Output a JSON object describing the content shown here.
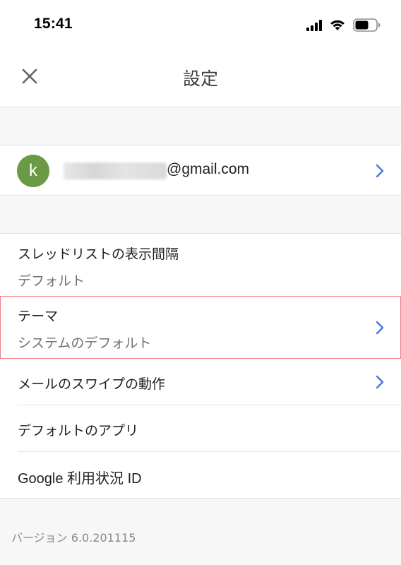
{
  "status_bar": {
    "time": "15:41",
    "icons": [
      "signal-icon",
      "wifi-icon",
      "battery-icon"
    ]
  },
  "header": {
    "close_icon": "close-icon",
    "title": "設定"
  },
  "account": {
    "avatar_letter": "k",
    "avatar_color": "#6a9a45",
    "email_domain": "@gmail.com",
    "email_local_part_redacted": true
  },
  "settings": {
    "items": [
      {
        "title": "スレッドリストの表示間隔",
        "subtitle": "デフォルト",
        "chevron": false
      },
      {
        "title": "テーマ",
        "subtitle": "システムのデフォルト",
        "chevron": true,
        "highlighted": true
      },
      {
        "title": "メールのスワイプの動作",
        "chevron": true
      },
      {
        "title": "デフォルトのアプリ",
        "chevron": false
      },
      {
        "title": "Google 利用状況 ID",
        "chevron": false
      }
    ]
  },
  "footer": {
    "version": "バージョン 6.0.201115"
  },
  "colors": {
    "accent_chevron": "#4a7ce0",
    "highlight_border": "#ef7f84",
    "background": "#f7f7f8"
  }
}
